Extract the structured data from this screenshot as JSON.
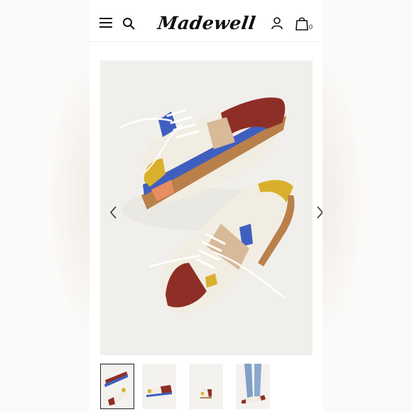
{
  "brand": {
    "logo_text": "Madewell"
  },
  "header": {
    "bag_count": "0",
    "icons": {
      "menu": "hamburger-menu-icon",
      "search": "search-icon",
      "account": "user-icon",
      "bag": "shopping-bag-icon"
    }
  },
  "gallery": {
    "selected_index": 0,
    "prev_icon": "chevron-left-icon",
    "next_icon": "chevron-right-icon",
    "thumbnail_count": 4
  },
  "colors": {
    "shoe_cream": "#f2ede2",
    "shoe_burgundy": "#8e2f27",
    "shoe_blue": "#3f5fc0",
    "shoe_mustard": "#d9b02c",
    "shoe_tan": "#d8b998",
    "shoe_coral": "#e98d63",
    "sole_gum": "#b9804a",
    "image_bg": "#f1efec"
  }
}
